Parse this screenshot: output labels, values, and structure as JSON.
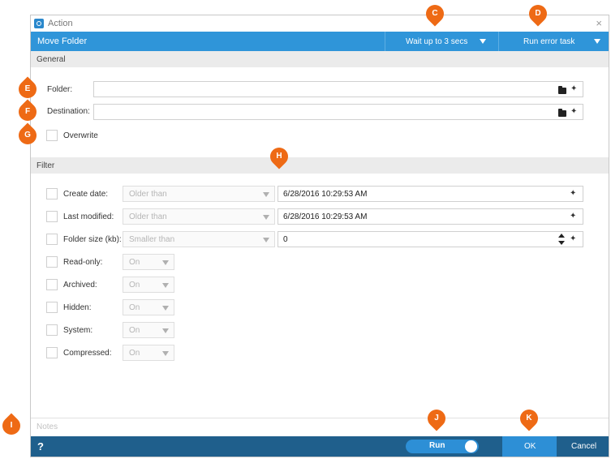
{
  "window": {
    "title": "Action",
    "close_glyph": "×"
  },
  "actionbar": {
    "action_name": "Move Folder",
    "wait_dropdown": "Wait up to 3 secs",
    "error_dropdown": "Run error task"
  },
  "general": {
    "header": "General",
    "folder_label": "Folder:",
    "folder_value": "",
    "destination_label": "Destination:",
    "destination_value": "",
    "overwrite_label": "Overwrite",
    "overwrite_checked": false
  },
  "filter": {
    "header": "Filter",
    "rows": [
      {
        "label": "Create date:",
        "operator": "Older than",
        "value": "6/28/2016 10:29:53 AM",
        "checked": false
      },
      {
        "label": "Last modified:",
        "operator": "Older than",
        "value": "6/28/2016 10:29:53 AM",
        "checked": false
      },
      {
        "label": "Folder size (kb):",
        "operator": "Smaller than",
        "value": "0",
        "checked": false
      },
      {
        "label": "Read-only:",
        "operator": "On",
        "checked": false
      },
      {
        "label": "Archived:",
        "operator": "On",
        "checked": false
      },
      {
        "label": "Hidden:",
        "operator": "On",
        "checked": false
      },
      {
        "label": "System:",
        "operator": "On",
        "checked": false
      },
      {
        "label": "Compressed:",
        "operator": "On",
        "checked": false
      }
    ]
  },
  "notes": {
    "placeholder": "Notes"
  },
  "footer": {
    "help": "?",
    "run": "Run",
    "ok": "OK",
    "cancel": "Cancel"
  },
  "callouts": [
    "C",
    "D",
    "E",
    "F",
    "G",
    "H",
    "I",
    "J",
    "K"
  ],
  "colors": {
    "accent": "#2f95d9",
    "footer": "#1f5f8c",
    "callout": "#ee6a15",
    "section_header": "#ebebeb"
  }
}
